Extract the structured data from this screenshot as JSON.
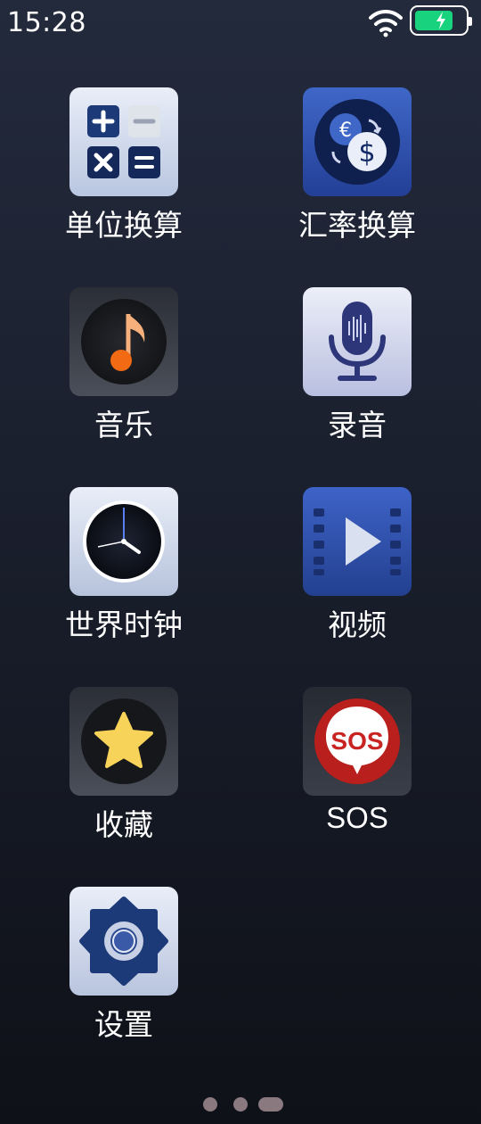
{
  "status_bar": {
    "time": "15:28",
    "icons": [
      "wifi-icon",
      "battery-charging-icon"
    ],
    "battery_level": 0.75,
    "battery_color": "#19d27d"
  },
  "apps": [
    {
      "label": "单位换算",
      "icon": "calculator-icon"
    },
    {
      "label": "汇率换算",
      "icon": "currency-exchange-icon"
    },
    {
      "label": "音乐",
      "icon": "music-note-icon"
    },
    {
      "label": "录音",
      "icon": "microphone-icon"
    },
    {
      "label": "世界时钟",
      "icon": "clock-icon"
    },
    {
      "label": "视频",
      "icon": "video-play-icon"
    },
    {
      "label": "收藏",
      "icon": "star-icon"
    },
    {
      "label": "SOS",
      "icon": "sos-icon"
    },
    {
      "label": "设置",
      "icon": "settings-gear-icon"
    }
  ],
  "sos_icon_text": "SOS",
  "pager": {
    "page_count": 3,
    "current_page": 3
  }
}
